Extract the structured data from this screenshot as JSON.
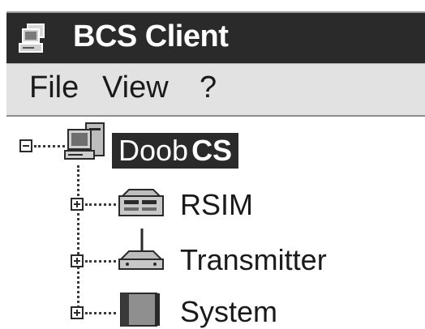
{
  "window": {
    "title": "BCS Client",
    "icon": "app-computer-icon"
  },
  "menu": [
    {
      "label": "File"
    },
    {
      "label": "View"
    },
    {
      "label": "?"
    }
  ],
  "tree": {
    "root": {
      "name_part1": "Doob",
      "name_part2": "CS",
      "icon": "server-computer-icon",
      "expanded": true,
      "selected": true
    },
    "children": [
      {
        "label": "RSIM",
        "icon": "rsim-device-icon",
        "expanded": false
      },
      {
        "label": "Transmitter",
        "icon": "transmitter-icon",
        "expanded": false
      },
      {
        "label": "System",
        "icon": "system-panel-icon",
        "expanded": false
      }
    ]
  },
  "colors": {
    "titlebar": "#2a2a2a",
    "menubar": "#e2e2e2",
    "selection": "#2a2a2a",
    "text": "#1a1a1a"
  }
}
